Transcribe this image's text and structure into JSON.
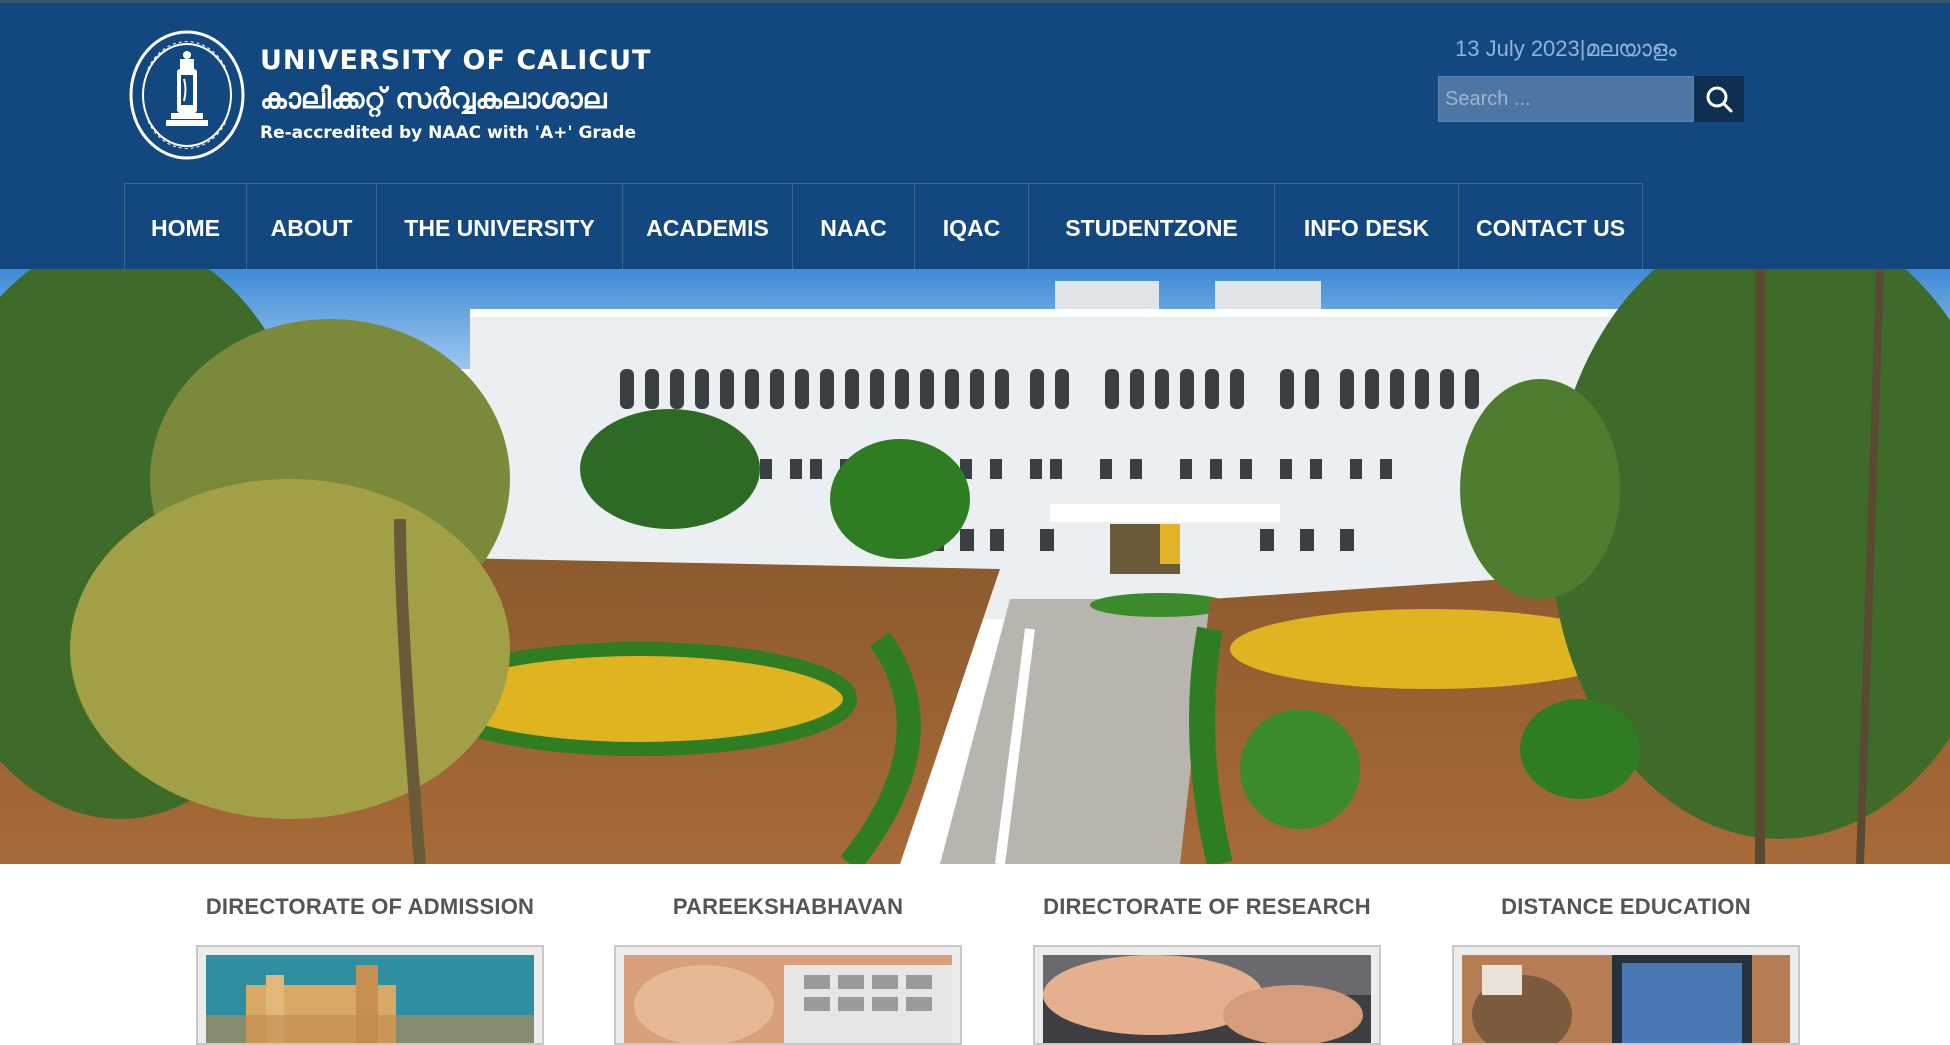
{
  "header": {
    "title_en": "UNIVERSITY OF CALICUT",
    "title_ml": "കാലിക്കറ്റ് സർവ്വകലാശാല",
    "subtitle": "Re-accredited by NAAC with 'A+' Grade",
    "date": "13 July 2023",
    "separator": "|",
    "language_link": "മലയാളം",
    "search": {
      "placeholder": "Search ..."
    },
    "icons": {
      "seal": "university-seal-logo",
      "search": "search-icon"
    }
  },
  "nav": {
    "items": [
      {
        "label": "HOME"
      },
      {
        "label": "ABOUT"
      },
      {
        "label": "THE UNIVERSITY"
      },
      {
        "label": "ACADEMIS"
      },
      {
        "label": "NAAC"
      },
      {
        "label": "IQAC"
      },
      {
        "label": "STUDENTZONE"
      },
      {
        "label": "INFO DESK"
      },
      {
        "label": "CONTACT US"
      }
    ]
  },
  "quick_links": [
    {
      "title": "DIRECTORATE OF ADMISSION"
    },
    {
      "title": "PAREEKSHABHAVAN"
    },
    {
      "title": "DIRECTORATE OF RESEARCH"
    },
    {
      "title": "DISTANCE EDUCATION"
    }
  ],
  "colors": {
    "header_bg": "#12487f",
    "nav_divider": "#3c6894",
    "search_bg": "#4e76a4",
    "search_button": "#0f2f52",
    "date_text": "#8fb3db",
    "card_title": "#555555"
  }
}
